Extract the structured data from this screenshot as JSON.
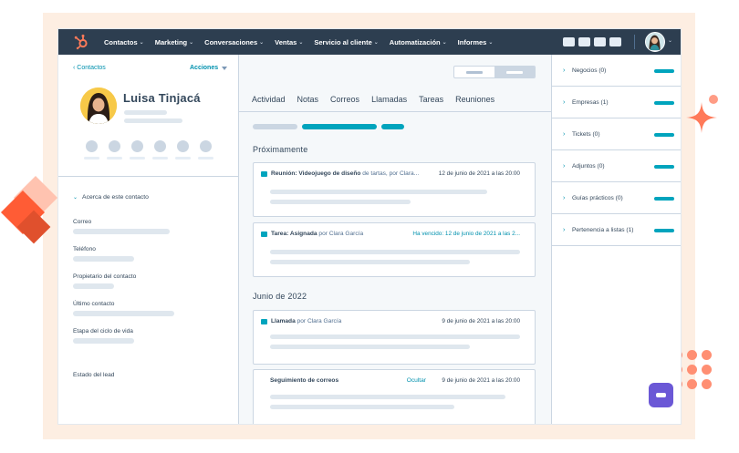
{
  "nav": {
    "items": [
      {
        "label": "Contactos"
      },
      {
        "label": "Marketing"
      },
      {
        "label": "Conversaciones"
      },
      {
        "label": "Ventas"
      },
      {
        "label": "Servicio al cliente"
      },
      {
        "label": "Automatización"
      },
      {
        "label": "Informes"
      }
    ]
  },
  "left": {
    "back_label": "Contactos",
    "actions_label": "Acciones",
    "contact_name": "Luisa Tinjacá",
    "about_label": "Acerca de este contacto",
    "fields": [
      {
        "label": "Correo"
      },
      {
        "label": "Teléfono"
      },
      {
        "label": "Propietario del contacto"
      },
      {
        "label": "Último contacto"
      },
      {
        "label": "Etapa del ciclo de vida"
      },
      {
        "label": "Estado del lead"
      }
    ]
  },
  "mid": {
    "tabs": [
      {
        "label": "Actividad"
      },
      {
        "label": "Notas"
      },
      {
        "label": "Correos"
      },
      {
        "label": "Llamadas"
      },
      {
        "label": "Tareas"
      },
      {
        "label": "Reuniones"
      }
    ],
    "section_upcoming": "Próximamente",
    "section_june": "Junio de 2022",
    "cards": [
      {
        "title": "Reunión: Videojuego de diseño",
        "by": " de tartas, por Clara...",
        "date": "12 de junio de 2021 a las 20:00"
      },
      {
        "title": "Tarea: Asignada",
        "by": " por Clara García",
        "date": "Ha vencido: 12 de junio de 2021 a las 2..."
      },
      {
        "title": "Llamada",
        "by": " por Clara García",
        "date": "9 de junio de 2021 a las 20:00"
      },
      {
        "title": "Seguimiento de correos",
        "by": "",
        "date": "9 de junio de 2021 a las 20:00",
        "hide_label": "Ocultar"
      }
    ]
  },
  "right": {
    "items": [
      {
        "label": "Negocios (0)"
      },
      {
        "label": "Empresas (1)"
      },
      {
        "label": "Tickets (0)"
      },
      {
        "label": "Adjuntos (0)"
      },
      {
        "label": "Guías prácticos (0)"
      },
      {
        "label": "Pertenencia a listas (1)"
      }
    ]
  },
  "colors": {
    "nav_bg": "#2d3e50",
    "accent_teal": "#00a4bd",
    "link": "#0091ae",
    "brand_orange": "#ff7a59",
    "frame_peach": "#fdeee2",
    "chat_purple": "#6b58d6"
  }
}
